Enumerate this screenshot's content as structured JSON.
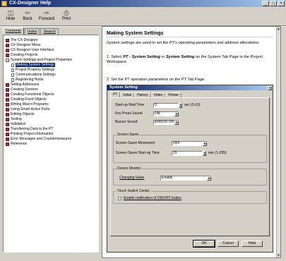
{
  "window": {
    "title": "CX-Designer Help",
    "controls": [
      "_",
      "□",
      "×"
    ]
  },
  "toolbar": [
    {
      "label": "Hide",
      "icon": "◫"
    },
    {
      "label": "Back",
      "icon": "⇦"
    },
    {
      "label": "Forward",
      "icon": "⇨"
    },
    {
      "label": "Print",
      "icon": "⎙"
    }
  ],
  "nav_tabs": [
    "Contents",
    "Index",
    "Search"
  ],
  "tree": [
    {
      "label": "The CX-Designer",
      "level": 0,
      "type": "book"
    },
    {
      "label": "CX-Designer Menu",
      "level": 0,
      "type": "book"
    },
    {
      "label": "CX-Designer User Interface",
      "level": 0,
      "type": "book"
    },
    {
      "label": "Creating Projects",
      "level": 0,
      "type": "book"
    },
    {
      "label": "System Settings and Project Properties",
      "level": 0,
      "type": "open"
    },
    {
      "label": "Making System Settings",
      "level": 1,
      "type": "page",
      "selected": true
    },
    {
      "label": "Project Property Settings",
      "level": 1,
      "type": "page"
    },
    {
      "label": "Communications Settings",
      "level": 1,
      "type": "page"
    },
    {
      "label": "Registering Hosts",
      "level": 1,
      "type": "page"
    },
    {
      "label": "Setting Addresses",
      "level": 0,
      "type": "book"
    },
    {
      "label": "Creating Screens",
      "level": 0,
      "type": "book"
    },
    {
      "label": "Creating Functional Objects",
      "level": 0,
      "type": "book"
    },
    {
      "label": "Creating Fixed Objects",
      "level": 0,
      "type": "book"
    },
    {
      "label": "Writing Macro Programs",
      "level": 0,
      "type": "book"
    },
    {
      "label": "Using Smart Active Parts",
      "level": 0,
      "type": "book"
    },
    {
      "label": "Editing Objects",
      "level": 0,
      "type": "book"
    },
    {
      "label": "Testing",
      "level": 0,
      "type": "book"
    },
    {
      "label": "Validation",
      "level": 0,
      "type": "book"
    },
    {
      "label": "Transferring Data to the PT",
      "level": 0,
      "type": "book"
    },
    {
      "label": "Printing Project Information",
      "level": 0,
      "type": "book"
    },
    {
      "label": "Error Messages and Countermeasures",
      "level": 0,
      "type": "book"
    },
    {
      "label": "Reference",
      "level": 0,
      "type": "book"
    }
  ],
  "content": {
    "title": "Making System Settings",
    "intro": "System settings are used to set the PT's operating parameters and address allocations.",
    "step1_prefix": "1. Select ",
    "step1_b1": "PT - System Setting",
    "step1_mid": " or ",
    "step1_b2": "System Setting",
    "step1_suffix": " on the System Tab Page in the Project Workspace.",
    "step2": "2. Set the PT operation parameters on the PT Tab Page."
  },
  "dialog": {
    "title": "System Setting",
    "tabs": [
      "PT",
      "Initial",
      "History",
      "Video",
      "Printer"
    ],
    "startup_wait_label": "Start-up Wait Time",
    "startup_wait_value": "0",
    "startup_wait_unit": "sec (0-10)",
    "key_press_label": "Key Press Sound",
    "key_press_value": "ON",
    "buzzer_label": "Buzzer Sound",
    "buzzer_value": "ERROR ON",
    "screen_saver_group": "Screen Saver",
    "saver_movement_label": "Screen Saver Movement",
    "saver_movement_value": "OFF",
    "saver_time_label": "Screen Saver Start-up Time",
    "saver_time_value": "15",
    "saver_time_unit": "min (1-255)",
    "device_monitor_group": "Device Monitor",
    "changing_value_label": "Changing Value",
    "changing_value_value": "Enable",
    "touch_switch_group": "Touch Switch Center",
    "touch_switch_check_label": "Enable notification of ON/OFF button",
    "ok_label": "OK",
    "cancel_label": "Cancel",
    "help_label": "Help"
  },
  "colors": {
    "titlebar": "#0a246a",
    "book_icon": "#a0303a",
    "selection": "#0a246a"
  }
}
